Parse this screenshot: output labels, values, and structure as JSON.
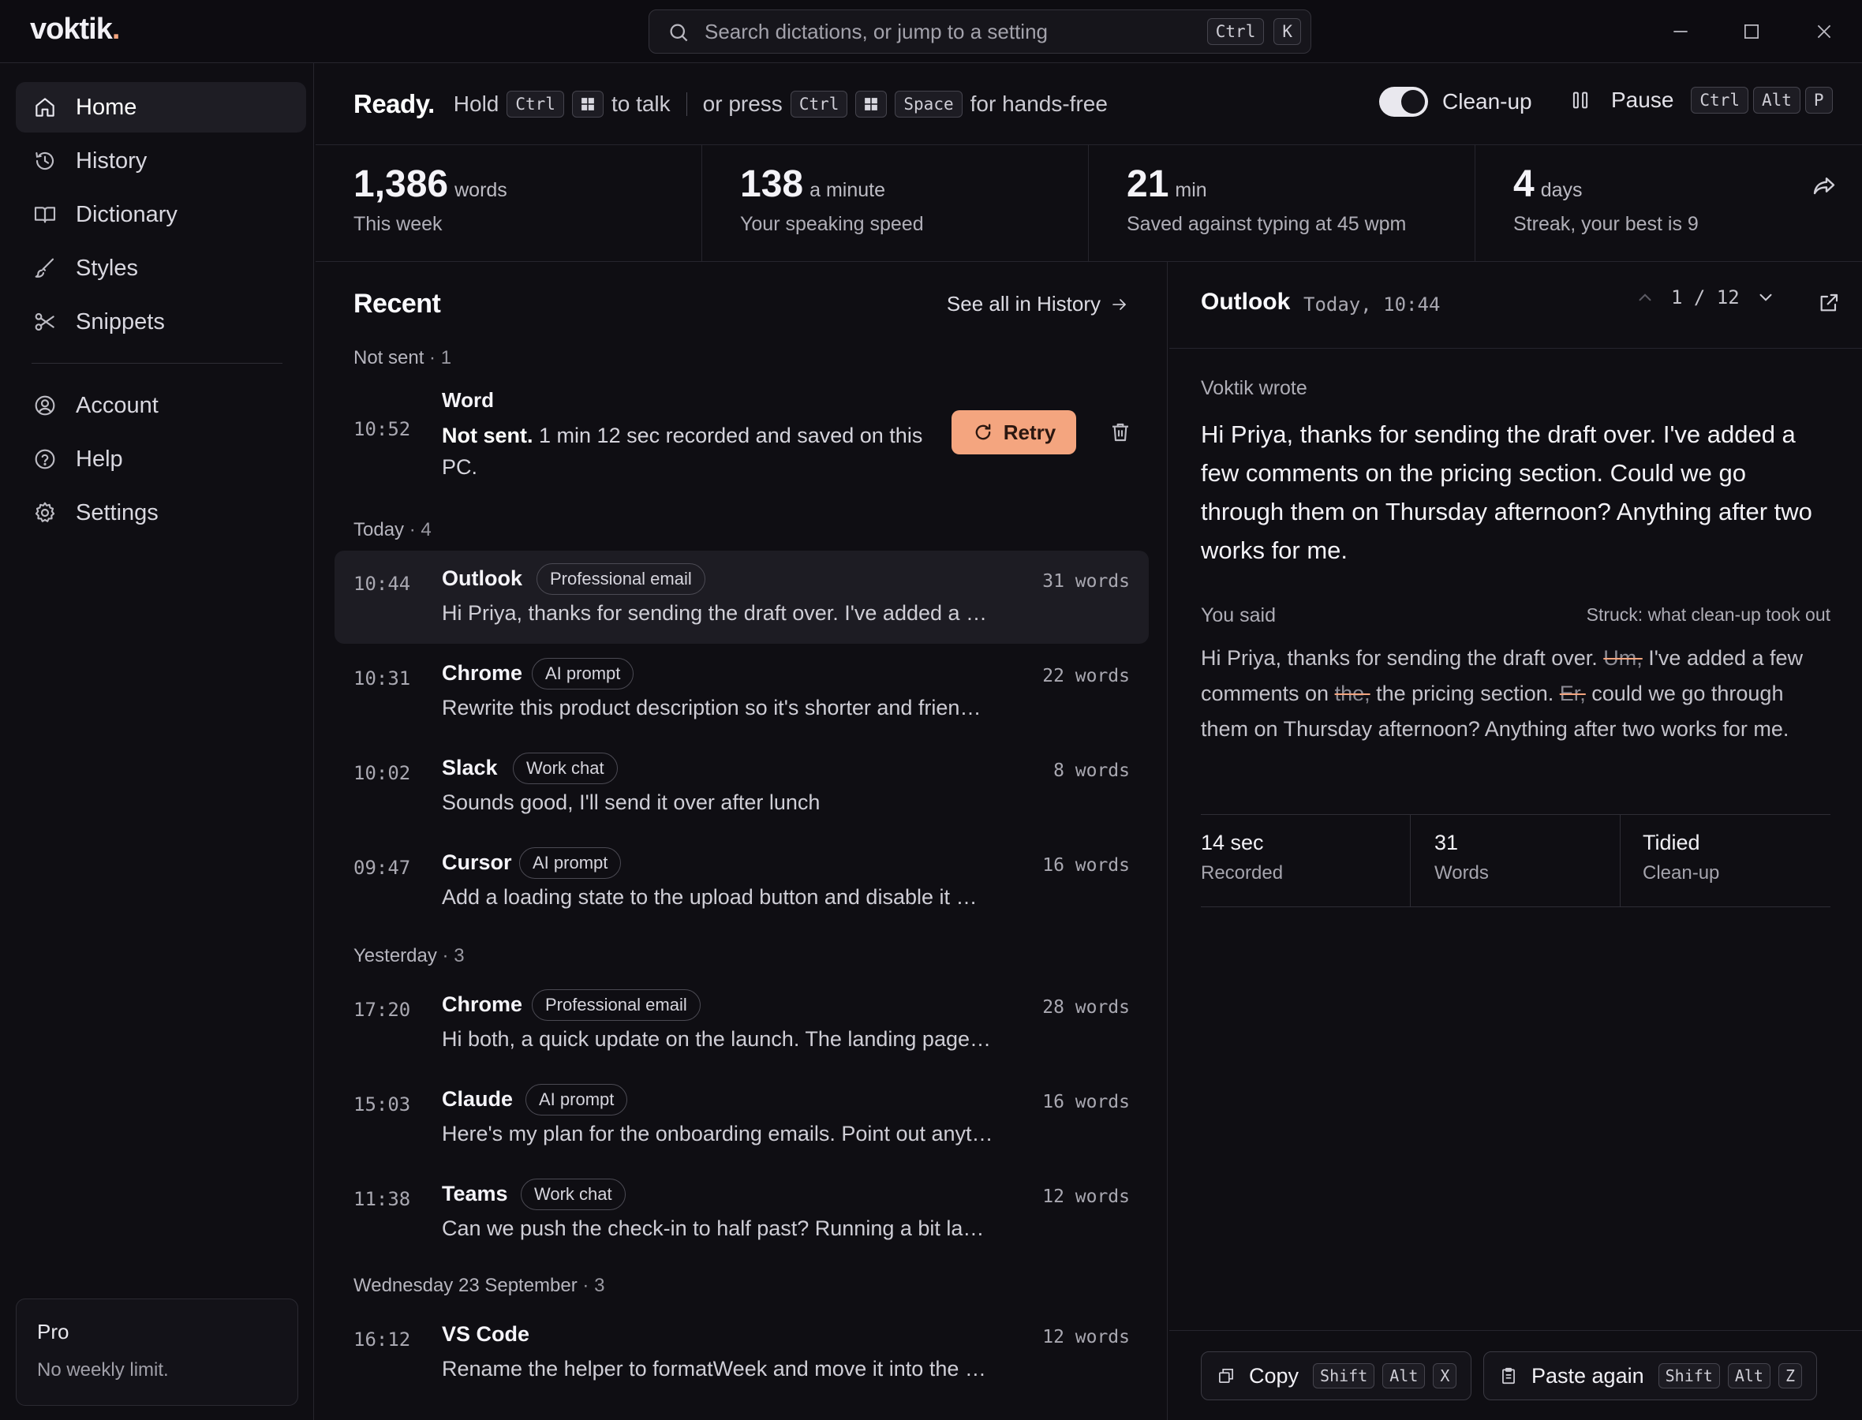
{
  "app": {
    "logo": "voktik",
    "logo_dot": "."
  },
  "search": {
    "placeholder": "Search dictations, or jump to a setting",
    "keys": [
      "Ctrl",
      "K"
    ]
  },
  "sidebar": {
    "items": [
      {
        "label": "Home",
        "icon": "home-icon",
        "active": true
      },
      {
        "label": "History",
        "icon": "history-icon"
      },
      {
        "label": "Dictionary",
        "icon": "book-icon"
      },
      {
        "label": "Styles",
        "icon": "brush-icon"
      },
      {
        "label": "Snippets",
        "icon": "scissors-icon"
      },
      {
        "label": "Account",
        "icon": "user-circle-icon"
      },
      {
        "label": "Help",
        "icon": "help-icon"
      },
      {
        "label": "Settings",
        "icon": "gear-icon"
      }
    ],
    "plan": {
      "name": "Pro",
      "desc": "No weekly limit."
    }
  },
  "status": {
    "ready": "Ready.",
    "hold": "Hold",
    "hold_key": "Ctrl",
    "to_talk": "to talk",
    "or_press": "or press",
    "press_key1": "Ctrl",
    "press_key2": "Space",
    "hands_free": "for hands-free",
    "cleanup_label": "Clean-up",
    "cleanup_on": true,
    "pause_label": "Pause",
    "pause_keys": [
      "Ctrl",
      "Alt",
      "P"
    ]
  },
  "stats": [
    {
      "value": "1,386",
      "unit": "words",
      "sub": "This week"
    },
    {
      "value": "138",
      "unit": "a minute",
      "sub": "Your speaking speed"
    },
    {
      "value": "21",
      "unit": "min",
      "sub": "Saved against typing at 45 wpm"
    },
    {
      "value": "4",
      "unit": "days",
      "sub": "Streak, your best is 9"
    }
  ],
  "recent": {
    "title": "Recent",
    "see_all": "See all in History",
    "groups": [
      {
        "label": "Not sent",
        "count": "1"
      },
      {
        "label": "Today",
        "count": "4"
      },
      {
        "label": "Yesterday",
        "count": "3"
      },
      {
        "label": "Wednesday 23 September",
        "count": "3"
      }
    ],
    "failed": {
      "time": "10:52",
      "app": "Word",
      "bold": "Not sent.",
      "msg": "1 min 12 sec recorded and saved on this PC.",
      "retry": "Retry"
    },
    "rows": [
      {
        "time": "10:44",
        "app": "Outlook",
        "tag": "Professional email",
        "words": "31 words",
        "preview": "Hi Priya, thanks for sending the draft over. I've added a …"
      },
      {
        "time": "10:31",
        "app": "Chrome",
        "tag": "AI prompt",
        "words": "22 words",
        "preview": "Rewrite this product description so it's shorter and frien…"
      },
      {
        "time": "10:02",
        "app": "Slack",
        "tag": "Work chat",
        "words": "8 words",
        "preview": "Sounds good, I'll send it over after lunch"
      },
      {
        "time": "09:47",
        "app": "Cursor",
        "tag": "AI prompt",
        "words": "16 words",
        "preview": "Add a loading state to the upload button and disable it …"
      },
      {
        "time": "17:20",
        "app": "Chrome",
        "tag": "Professional email",
        "words": "28 words",
        "preview": "Hi both, a quick update on the launch. The landing page…"
      },
      {
        "time": "15:03",
        "app": "Claude",
        "tag": "AI prompt",
        "words": "16 words",
        "preview": "Here's my plan for the onboarding emails. Point out anyt…"
      },
      {
        "time": "11:38",
        "app": "Teams",
        "tag": "Work chat",
        "words": "12 words",
        "preview": "Can we push the check-in to half past? Running a bit la…"
      },
      {
        "time": "16:12",
        "app": "VS Code",
        "tag": "",
        "words": "12 words",
        "preview": "Rename the helper to formatWeek and move it into the …"
      }
    ]
  },
  "detail": {
    "app": "Outlook",
    "time": "Today,  10:44",
    "pager": "1 / 12",
    "wrote_label": "Voktik wrote",
    "wrote": "Hi Priya, thanks for sending the draft over. I've added a few comments on the pricing section. Could we go through them on Thursday afternoon? Anything after two works for me.",
    "said_label": "You said",
    "said_hint": "Struck: what clean-up took out",
    "said_parts": [
      {
        "t": "Hi Priya, thanks for sending the draft over. ",
        "struck": false
      },
      {
        "t": "Um,",
        "struck": true
      },
      {
        "t": " I've added a few comments on ",
        "struck": false
      },
      {
        "t": "the,",
        "struck": true
      },
      {
        "t": " the pricing section. ",
        "struck": false
      },
      {
        "t": "Er,",
        "struck": true
      },
      {
        "t": " could we go through them on Thursday afternoon? Anything after two works for me.",
        "struck": false
      }
    ],
    "meta": [
      {
        "value": "14  sec",
        "label": "Recorded"
      },
      {
        "value": "31",
        "label": "Words"
      },
      {
        "value": "Tidied",
        "label": "Clean-up"
      }
    ],
    "copy": {
      "label": "Copy",
      "keys": [
        "Shift",
        "Alt",
        "X"
      ]
    },
    "paste": {
      "label": "Paste again",
      "keys": [
        "Shift",
        "Alt",
        "Z"
      ]
    }
  },
  "colors": {
    "accent": "#f4a57f",
    "background": "#0f0e13",
    "selected": "#1d1c23"
  }
}
